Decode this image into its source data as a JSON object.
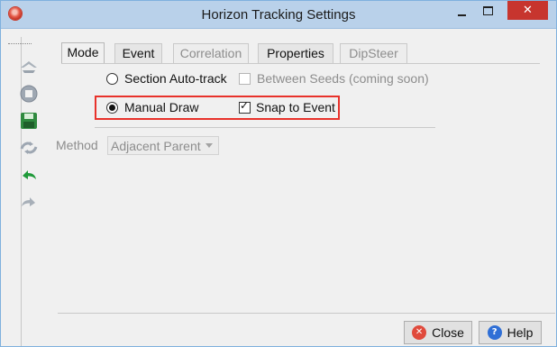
{
  "window": {
    "title": "Horizon Tracking Settings",
    "close_glyph": "✕",
    "controls": [
      "minimize",
      "maximize",
      "close"
    ]
  },
  "toolbar": {
    "icons": [
      "ship-icon",
      "stop-icon",
      "save-icon",
      "retrack-icon",
      "undo-icon",
      "redo-icon"
    ]
  },
  "tabs": [
    {
      "label": "Mode",
      "state": "active"
    },
    {
      "label": "Event",
      "state": "enabled"
    },
    {
      "label": "Correlation",
      "state": "disabled"
    },
    {
      "label": "Properties",
      "state": "enabled"
    },
    {
      "label": "DipSteer",
      "state": "disabled"
    }
  ],
  "mode": {
    "section_autotrack": {
      "label": "Section Auto-track",
      "checked": false
    },
    "between_seeds": {
      "label": "Between Seeds (coming soon)",
      "checked": false,
      "enabled": false
    },
    "manual_draw": {
      "label": "Manual Draw",
      "checked": true
    },
    "snap_to_event": {
      "label": "Snap to Event",
      "checked": true
    }
  },
  "method": {
    "label": "Method",
    "selected": "Adjacent Parent",
    "enabled": false
  },
  "buttons": {
    "close": "Close",
    "help": "Help",
    "help_glyph": "?",
    "close_glyph": "✕"
  },
  "colors": {
    "titlebar": "#b9d1ea",
    "close_button": "#c7352e",
    "highlight_border": "#e8322b",
    "help_icon": "#2f6fd6",
    "close_icon": "#e04a3c"
  }
}
